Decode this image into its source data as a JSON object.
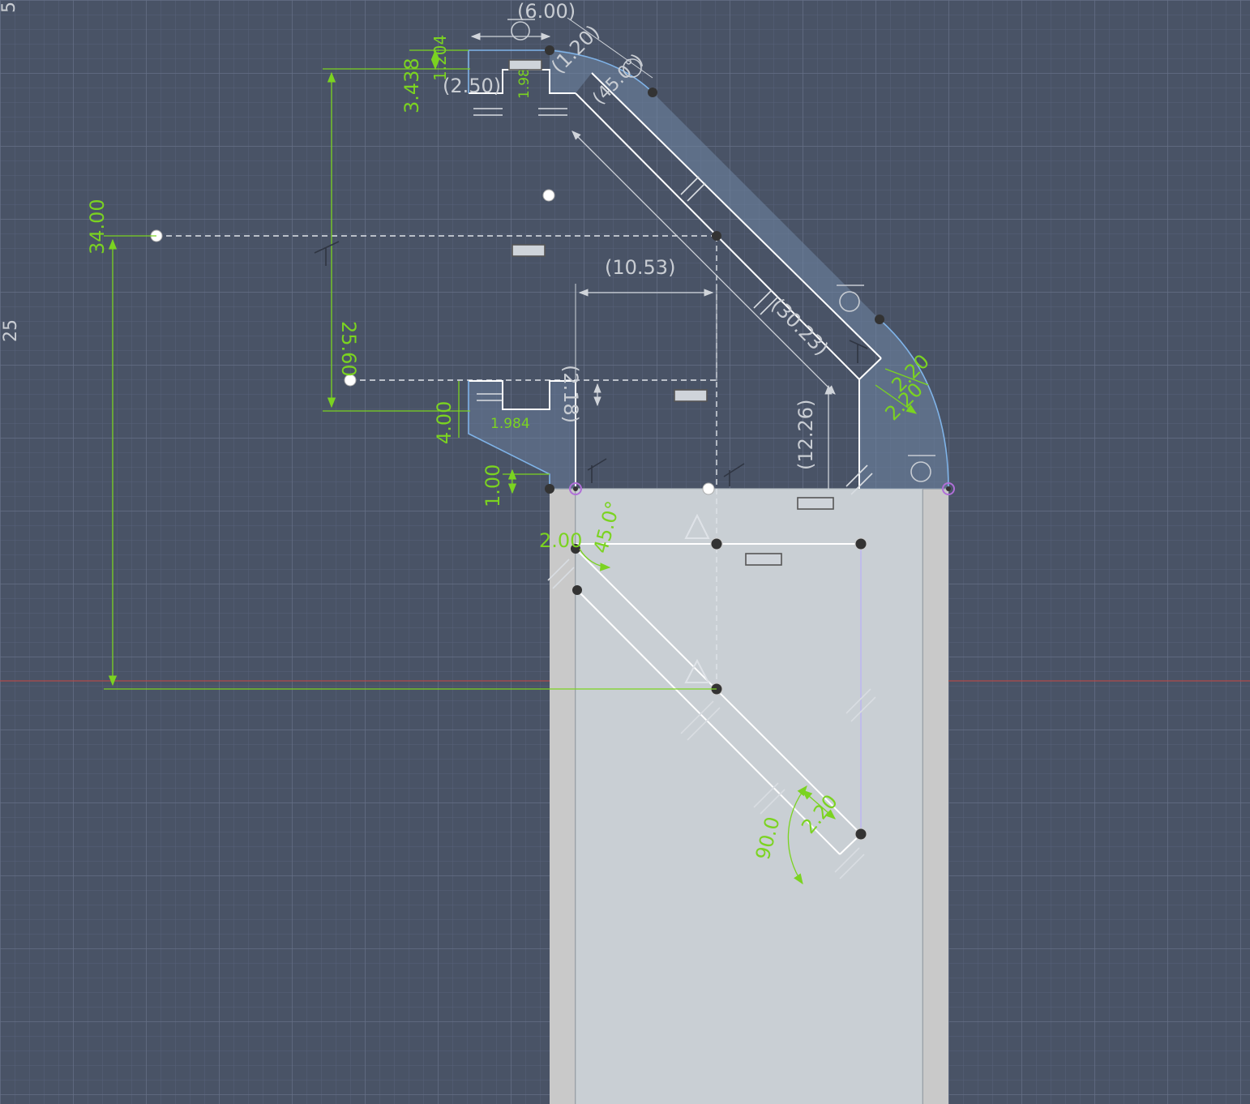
{
  "canvas": {
    "background": "#495366",
    "grid_minor": "#58627a",
    "grid_major": "#626d85",
    "origin_axis_color": "#b04a4a"
  },
  "ruler": {
    "top_tick": "5",
    "mid_tick": "25"
  },
  "colors": {
    "driven_dimension": "#7bd321",
    "reference_dimension": "#c9cdd3",
    "sketch_line": "#ffffff",
    "profile_fill": "#8aa4c2",
    "body_fill": "#c7cdd2",
    "body_edge": "#bfbfbf",
    "projected_line": "#7fa9d9"
  },
  "dimensions": {
    "driven": {
      "d_34": "34.00",
      "d_25_60": "25.60",
      "d_4_00": "4.00",
      "d_1_00": "1.00",
      "d_3_438": "3.438",
      "d_1_204": "1.204",
      "d_1_984_top": "1.984",
      "d_1_984_mid": "1.984",
      "d_2_20_right_a": "2.20",
      "d_2_20_right_b": "2.20",
      "d_2_20_lower": "2.20",
      "d_2_00": "2.00",
      "angle_45": "45.0°",
      "angle_90": "90.0"
    },
    "reference": {
      "r_6_00": "(6.00)",
      "r_2_50": "(2.50)",
      "r_10_53": "(10.53)",
      "r_30_23": "(30.23)",
      "r_12_26": "(12.26)",
      "r_2_18": "(2.18)",
      "r_1_20": "(1.20)",
      "r_45_0": "(45.0°)"
    }
  },
  "constraint_icons": [
    "horizontal-constraint-icon",
    "parallel-constraint-icon",
    "perpendicular-constraint-icon",
    "tangent-constraint-icon",
    "equal-constraint-icon",
    "symmetry-constraint-icon"
  ]
}
